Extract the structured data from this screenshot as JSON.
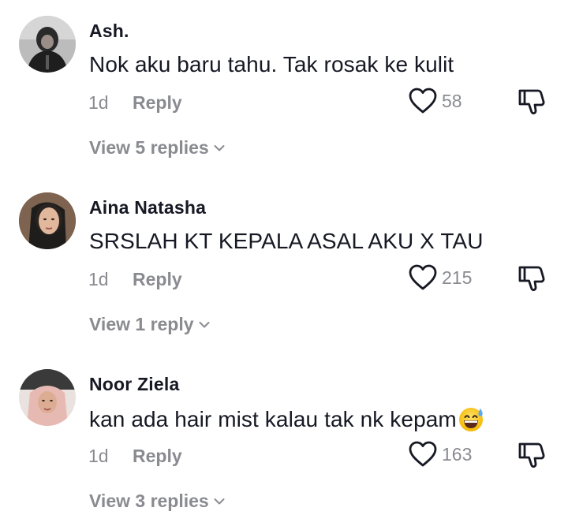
{
  "comments": [
    {
      "username": "Ash.",
      "text": "Nok aku baru tahu. Tak rosak ke kulit",
      "time": "1d",
      "reply_label": "Reply",
      "likes": "58",
      "view_replies": "View 5 replies"
    },
    {
      "username": "Aina Natasha",
      "text": "SRSLAH KT KEPALA ASAL AKU X TAU",
      "time": "1d",
      "reply_label": "Reply",
      "likes": "215",
      "view_replies": "View 1 reply"
    },
    {
      "username": "Noor Ziela",
      "text": "kan ada hair mist kalau tak nk kepam",
      "emoji": "grinning-face-with-sweat",
      "time": "1d",
      "reply_label": "Reply",
      "likes": "163",
      "view_replies": "View 3 replies"
    }
  ],
  "icons": {
    "like": "heart-outline-icon",
    "dislike": "thumbs-down-outline-icon",
    "expand": "chevron-down-icon"
  },
  "colors": {
    "text_primary": "#161823",
    "text_secondary": "#8a8b91",
    "icon": "#161823"
  }
}
